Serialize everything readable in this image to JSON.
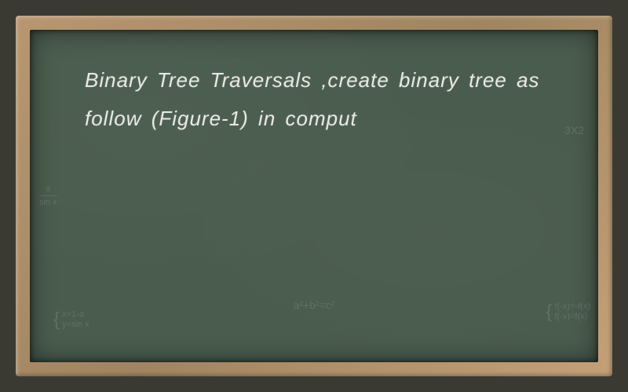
{
  "main_text": "Binary Tree Traversals ,create binary tree as follow (Figure-1) in comput",
  "watermarks": {
    "left_numerator": "a",
    "left_denominator": "sin x",
    "right_top": "3X2",
    "bottom_left_line1": "x=1-a",
    "bottom_left_line2": "y=sin x",
    "bottom_center": "a²+b²=c²",
    "right_bottom_line1": "f(-x)=-f(x)",
    "right_bottom_line2": "f(-x)=f(x)"
  }
}
